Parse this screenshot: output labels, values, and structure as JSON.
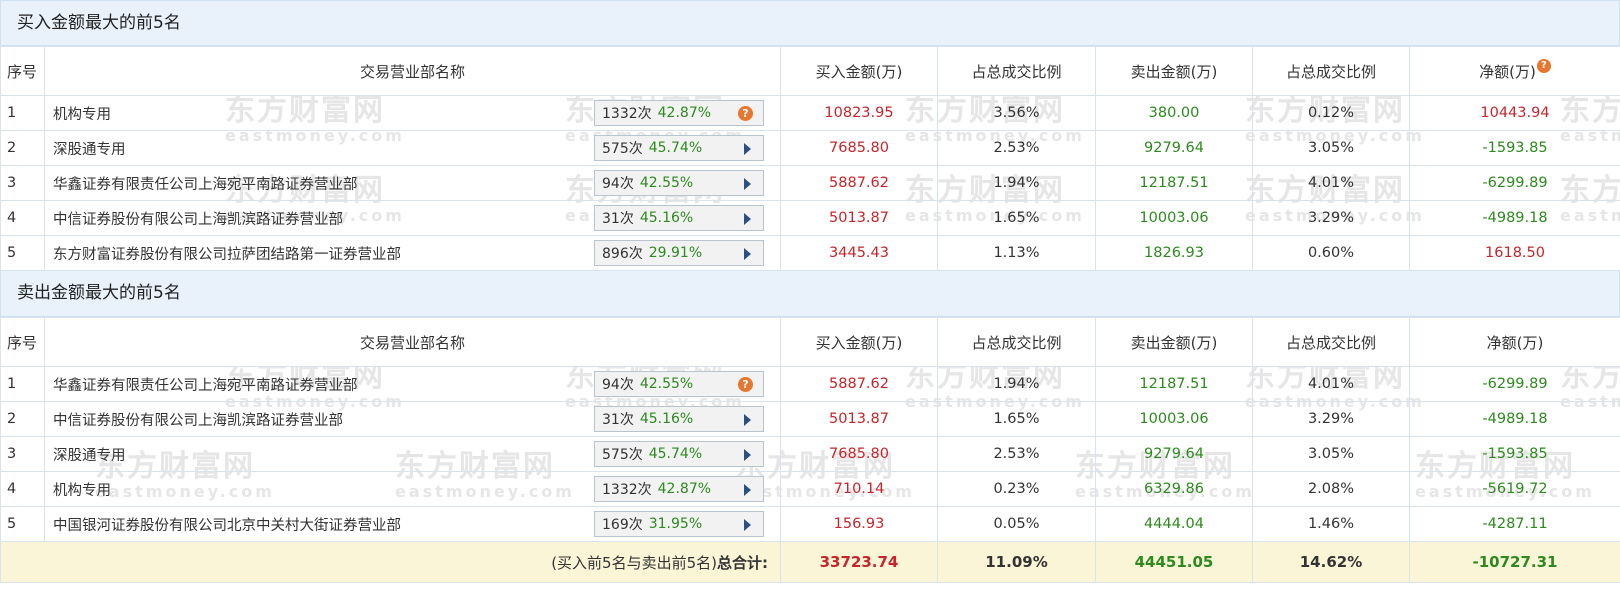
{
  "watermark": {
    "cn": "东方财富网",
    "en": "eastmoney.com"
  },
  "buy_section": {
    "title": "买入金额最大的前5名",
    "headers": [
      "序号",
      "交易营业部名称",
      "买入金额(万)",
      "占总成交比例",
      "卖出金额(万)",
      "占总成交比例",
      "净额(万)"
    ],
    "rows": [
      {
        "idx": "1",
        "name": "机构专用",
        "count": "1332次",
        "ratio": "42.87%",
        "icon": "help-icon",
        "buy": "10823.95",
        "buy_pct": "3.56%",
        "sell": "380.00",
        "sell_pct": "0.12%",
        "net": "10443.94",
        "net_color": "red"
      },
      {
        "idx": "2",
        "name": "深股通专用",
        "count": "575次",
        "ratio": "45.74%",
        "icon": "arrow-right-icon",
        "buy": "7685.80",
        "buy_pct": "2.53%",
        "sell": "9279.64",
        "sell_pct": "3.05%",
        "net": "-1593.85",
        "net_color": "green"
      },
      {
        "idx": "3",
        "name": "华鑫证券有限责任公司上海宛平南路证券营业部",
        "count": "94次",
        "ratio": "42.55%",
        "icon": "arrow-right-icon",
        "buy": "5887.62",
        "buy_pct": "1.94%",
        "sell": "12187.51",
        "sell_pct": "4.01%",
        "net": "-6299.89",
        "net_color": "green"
      },
      {
        "idx": "4",
        "name": "中信证券股份有限公司上海凯滨路证券营业部",
        "count": "31次",
        "ratio": "45.16%",
        "icon": "arrow-right-icon",
        "buy": "5013.87",
        "buy_pct": "1.65%",
        "sell": "10003.06",
        "sell_pct": "3.29%",
        "net": "-4989.18",
        "net_color": "green"
      },
      {
        "idx": "5",
        "name": "东方财富证券股份有限公司拉萨团结路第一证券营业部",
        "count": "896次",
        "ratio": "29.91%",
        "icon": "arrow-right-icon",
        "buy": "3445.43",
        "buy_pct": "1.13%",
        "sell": "1826.93",
        "sell_pct": "0.60%",
        "net": "1618.50",
        "net_color": "red"
      }
    ]
  },
  "sell_section": {
    "title": "卖出金额最大的前5名",
    "headers": [
      "序号",
      "交易营业部名称",
      "买入金额(万)",
      "占总成交比例",
      "卖出金额(万)",
      "占总成交比例",
      "净额(万)"
    ],
    "rows": [
      {
        "idx": "1",
        "name": "华鑫证券有限责任公司上海宛平南路证券营业部",
        "count": "94次",
        "ratio": "42.55%",
        "icon": "help-icon",
        "buy": "5887.62",
        "buy_pct": "1.94%",
        "sell": "12187.51",
        "sell_pct": "4.01%",
        "net": "-6299.89",
        "net_color": "green"
      },
      {
        "idx": "2",
        "name": "中信证券股份有限公司上海凯滨路证券营业部",
        "count": "31次",
        "ratio": "45.16%",
        "icon": "arrow-right-icon",
        "buy": "5013.87",
        "buy_pct": "1.65%",
        "sell": "10003.06",
        "sell_pct": "3.29%",
        "net": "-4989.18",
        "net_color": "green"
      },
      {
        "idx": "3",
        "name": "深股通专用",
        "count": "575次",
        "ratio": "45.74%",
        "icon": "arrow-right-icon",
        "buy": "7685.80",
        "buy_pct": "2.53%",
        "sell": "9279.64",
        "sell_pct": "3.05%",
        "net": "-1593.85",
        "net_color": "green"
      },
      {
        "idx": "4",
        "name": "机构专用",
        "count": "1332次",
        "ratio": "42.87%",
        "icon": "arrow-right-icon",
        "buy": "710.14",
        "buy_pct": "0.23%",
        "sell": "6329.86",
        "sell_pct": "2.08%",
        "net": "-5619.72",
        "net_color": "green"
      },
      {
        "idx": "5",
        "name": "中国银河证券股份有限公司北京中关村大街证券营业部",
        "count": "169次",
        "ratio": "31.95%",
        "icon": "arrow-right-icon",
        "buy": "156.93",
        "buy_pct": "0.05%",
        "sell": "4444.04",
        "sell_pct": "1.46%",
        "net": "-4287.11",
        "net_color": "green"
      }
    ]
  },
  "total": {
    "label_prefix": "(买入前5名与卖出前5名)",
    "label_bold": "总合计:",
    "buy": "33723.74",
    "buy_pct": "11.09%",
    "sell": "44451.05",
    "sell_pct": "14.62%",
    "net": "-10727.31"
  },
  "colors": {
    "buy": "#c7252b",
    "sell": "#2d8a1f",
    "header_bg": "#e9f2fb",
    "total_bg": "#fbf5d8",
    "help_icon": "#e7772f"
  },
  "help_glyph": "?"
}
